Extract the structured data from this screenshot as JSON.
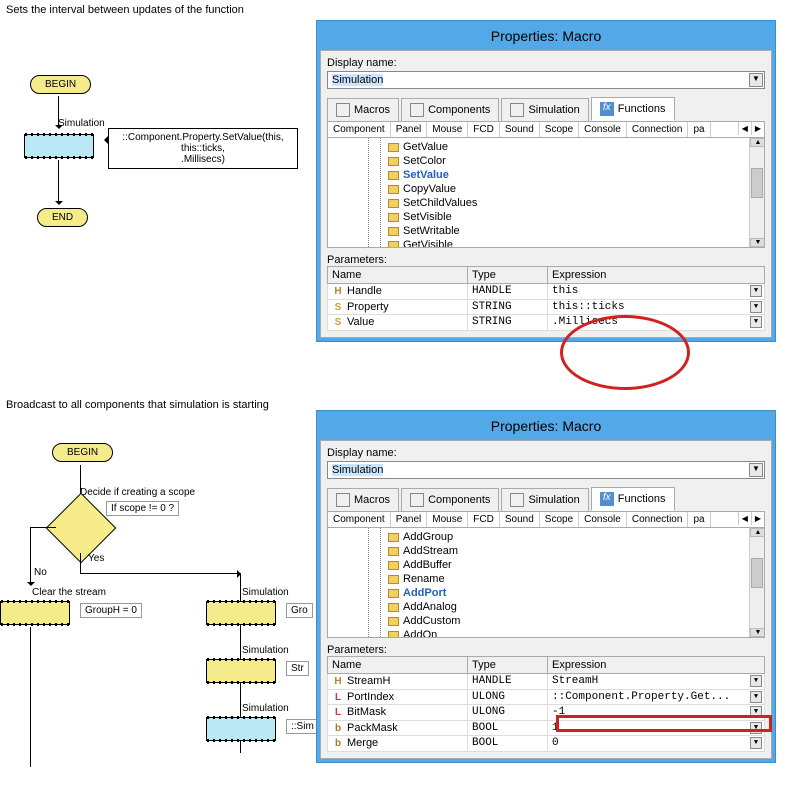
{
  "section1": {
    "title": "Sets the interval between updates of the function",
    "begin": "BEGIN",
    "end": "END",
    "sim_label": "Simulation",
    "callout": "::Component.Property.SetValue(this,\nthis::ticks,\n.Millisecs)"
  },
  "section2": {
    "title": "Broadcast to all components that simulation is starting",
    "begin": "BEGIN",
    "decide_label": "Decide if creating a scope",
    "scope_cond": "If  scope != 0 ?",
    "yes": "Yes",
    "no": "No",
    "clear_label": "Clear the stream",
    "clear_box": "GroupH = 0",
    "sim_label": "Simulation",
    "gro": "Gro",
    "str": "Str",
    "sim_colon": "::Sim"
  },
  "panel1": {
    "title": "Properties: Macro",
    "display_name_label": "Display name:",
    "display_name_value": "Simulation",
    "tabs": {
      "macros": "Macros",
      "components": "Components",
      "simulation": "Simulation",
      "functions": "Functions"
    },
    "subtabs": [
      "Component",
      "Panel",
      "Mouse",
      "FCD",
      "Sound",
      "Scope",
      "Console",
      "Connection",
      "pa"
    ],
    "tree_items": [
      "GetValue",
      "SetColor",
      "SetValue",
      "CopyValue",
      "SetChildValues",
      "SetVisible",
      "SetWritable",
      "GetVisible"
    ],
    "tree_selected": "SetValue",
    "parameters_label": "Parameters:",
    "param_headers": [
      "Name",
      "Type",
      "Expression"
    ],
    "params": [
      {
        "icon": "H",
        "iconClass": "type-h",
        "name": "Handle",
        "type": "HANDLE",
        "expr": "this"
      },
      {
        "icon": "S",
        "iconClass": "type-s",
        "name": "Property",
        "type": "STRING",
        "expr": "this::ticks"
      },
      {
        "icon": "S",
        "iconClass": "type-s",
        "name": "Value",
        "type": "STRING",
        "expr": ".Millisecs"
      }
    ]
  },
  "panel2": {
    "title": "Properties: Macro",
    "display_name_label": "Display name:",
    "display_name_value": "Simulation",
    "tabs": {
      "macros": "Macros",
      "components": "Components",
      "simulation": "Simulation",
      "functions": "Functions"
    },
    "subtabs": [
      "Component",
      "Panel",
      "Mouse",
      "FCD",
      "Sound",
      "Scope",
      "Console",
      "Connection",
      "pa"
    ],
    "tree_items": [
      "AddGroup",
      "AddStream",
      "AddBuffer",
      "Rename",
      "AddPort",
      "AddAnalog",
      "AddCustom",
      "AddOn"
    ],
    "tree_selected": "AddPort",
    "parameters_label": "Parameters:",
    "param_headers": [
      "Name",
      "Type",
      "Expression"
    ],
    "params": [
      {
        "icon": "H",
        "iconClass": "type-h",
        "name": "StreamH",
        "type": "HANDLE",
        "expr": "StreamH"
      },
      {
        "icon": "L",
        "iconClass": "type-l",
        "name": "PortIndex",
        "type": "ULONG",
        "expr": "::Component.Property.Get..."
      },
      {
        "icon": "L",
        "iconClass": "type-l",
        "name": "BitMask",
        "type": "ULONG",
        "expr": "-1"
      },
      {
        "icon": "b",
        "iconClass": "type-b",
        "name": "PackMask",
        "type": "BOOL",
        "expr": "1"
      },
      {
        "icon": "b",
        "iconClass": "type-b",
        "name": "Merge",
        "type": "BOOL",
        "expr": "0"
      }
    ]
  }
}
